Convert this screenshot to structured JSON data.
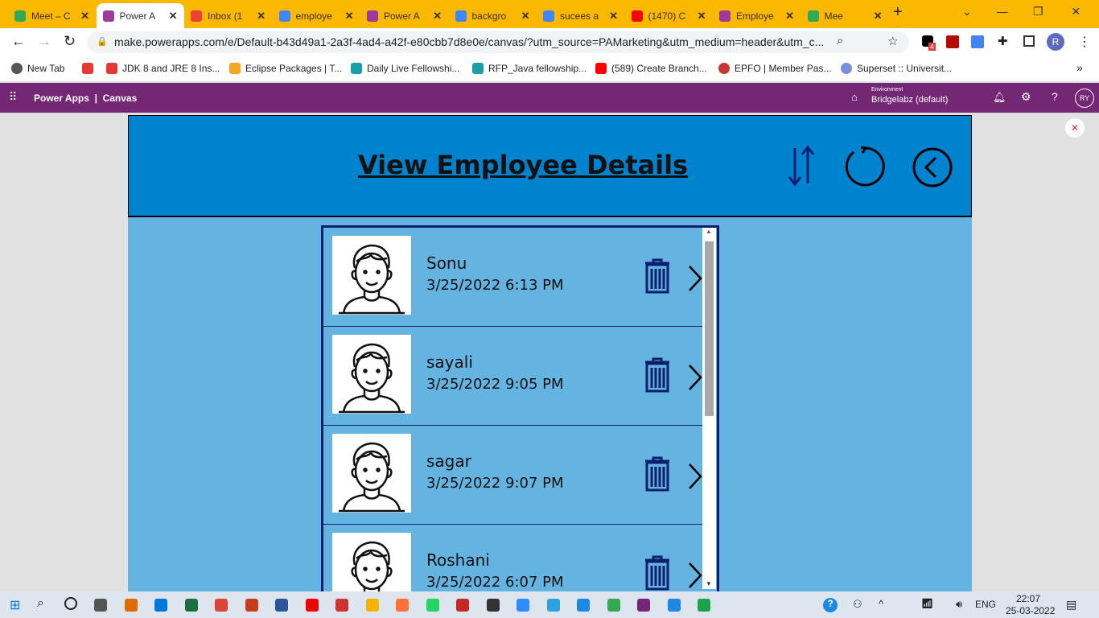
{
  "browser": {
    "tabs": [
      {
        "label": "Meet – C",
        "color": "#34a853"
      },
      {
        "label": "Power A",
        "color": "#9b3c9b",
        "active": true
      },
      {
        "label": "Inbox (1",
        "color": "#ea4335"
      },
      {
        "label": "employe",
        "color": "#4285f4"
      },
      {
        "label": "Power A",
        "color": "#9b3c9b"
      },
      {
        "label": "backgro",
        "color": "#4285f4"
      },
      {
        "label": "sucees a",
        "color": "#4285f4"
      },
      {
        "label": "(1470) C",
        "color": "#ff0000"
      },
      {
        "label": "Employe",
        "color": "#9b3c9b"
      },
      {
        "label": "Mee",
        "color": "#34a853"
      }
    ],
    "url": "make.powerapps.com/e/Default-b43d49a1-2a3f-4ad4-a42f-e80cbb7d8e0e/canvas/?utm_source=PAMarketing&utm_medium=header&utm_c...",
    "extension_badge": "4",
    "profile": "R",
    "bookmarks": [
      "New Tab",
      "",
      "JDK 8 and JRE 8 Ins...",
      "Eclipse Packages | T...",
      "Daily Live Fellowshi...",
      "RFP_Java fellowship...",
      "(589) Create Branch...",
      "EPFO | Member Pas...",
      "Superset :: Universit..."
    ]
  },
  "powerapps": {
    "brand": "Power Apps  |  Canvas",
    "env_label": "Environment",
    "env_name": "Bridgelabz (default)",
    "avatar": "RY"
  },
  "app": {
    "title": "View Employee Details",
    "employees": [
      {
        "name": "Sonu",
        "date": "3/25/2022 6:13 PM"
      },
      {
        "name": "sayali",
        "date": "3/25/2022 9:05 PM"
      },
      {
        "name": "sagar",
        "date": "3/25/2022 9:07 PM"
      },
      {
        "name": "Roshani",
        "date": "3/25/2022 6:07 PM"
      }
    ]
  },
  "taskbar": {
    "lang": "ENG",
    "time": "22:07",
    "date": "25-03-2022"
  }
}
